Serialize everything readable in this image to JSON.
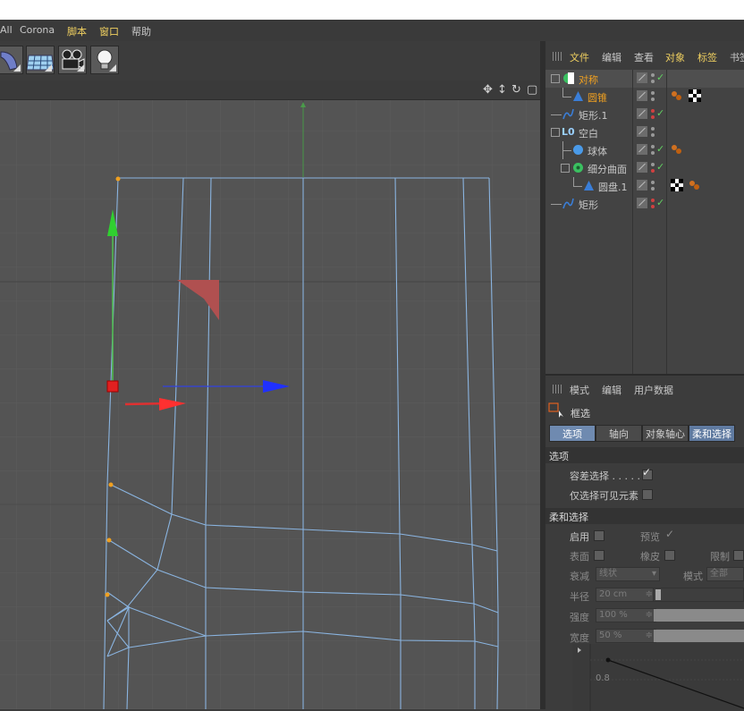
{
  "menubar": {
    "items": [
      "All",
      "Corona",
      "脚本",
      "窗口",
      "帮助"
    ]
  },
  "toolbar": {
    "icons": [
      "deformer-icon",
      "floor-grid-icon",
      "camera-icon",
      "light-bulb-icon"
    ]
  },
  "viewport": {
    "nav_icons": [
      "move-view-icon",
      "zoom-view-icon",
      "rotate-view-icon",
      "maximize-view-icon"
    ]
  },
  "object_manager": {
    "menu": [
      "文件",
      "编辑",
      "查看",
      "对象",
      "标签",
      "书签"
    ],
    "objects": [
      {
        "name": "对称"
      },
      {
        "name": "圆锥"
      },
      {
        "name": "矩形.1"
      },
      {
        "name": "空白"
      },
      {
        "name": "球体"
      },
      {
        "name": "细分曲面"
      },
      {
        "name": "圆盘.1"
      },
      {
        "name": "矩形"
      }
    ]
  },
  "attribute_manager": {
    "menu": [
      "模式",
      "编辑",
      "用户数据"
    ],
    "tool_name": "框选",
    "tabs": [
      "选项",
      "轴向",
      "对象轴心",
      "柔和选择"
    ],
    "section_options": "选项",
    "tolerance_label": "容差选择 . . . . .",
    "tolerance_checked": "✓",
    "visible_only_label": "仅选择可见元素",
    "section_soft": "柔和选择",
    "enable_label": "启用",
    "preview_label": "预览",
    "preview_checked": "✓",
    "surface_label": "表面",
    "rubber_label": "橡皮",
    "limit_label": "限制",
    "falloff_label": "衰减",
    "falloff_value": "线状",
    "mode_label": "模式",
    "mode_value": "全部",
    "radius_label": "半径",
    "radius_value": "20 cm",
    "strength_label": "强度",
    "strength_value": "100 %",
    "width_label": "宽度",
    "width_value": "50 %",
    "graph_tick": "0.8",
    "spin_symbol": "≑"
  },
  "colors": {
    "accent_yellow": "#f0d060",
    "selected_tab": "#6f8ab0",
    "wire": "#8ab4e0",
    "viewport_bg": "#545454"
  }
}
